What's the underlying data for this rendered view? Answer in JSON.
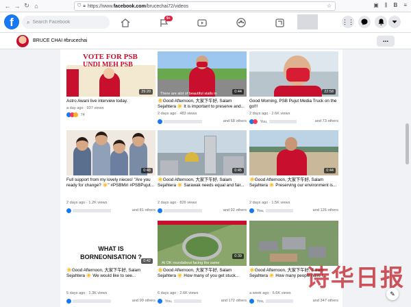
{
  "browser": {
    "url_prefix": "https://www.",
    "url_domain": "facebook.com",
    "url_path": "/brucechai72/videos",
    "account_initial": "B"
  },
  "fb": {
    "search_placeholder": "Search Facebook",
    "notification_badge": "9+",
    "brand_color": "#1877f2"
  },
  "profile": {
    "name": "BRUCE CHAI #brucechai",
    "more_label": "..."
  },
  "videos": [
    {
      "duration": "29:20",
      "title": "Astro Awani live interview today.",
      "meta": "a day ago · 937 views",
      "reactions_text": "74",
      "reactions_right": "",
      "thumb_text_1": "VOTE FOR PSB",
      "thumb_text_2": "UNDI MEH PSB"
    },
    {
      "duration": "0:44",
      "title": "☀️Good Afternoon, 大家下午好, Salam Sejahtera ☀️ It is important to preserve and...",
      "meta": "2 days ago · 483 views",
      "reactions_text": "",
      "reactions_right": "and 68 others",
      "thumb_caption": "There are alot of beautiful stalls in"
    },
    {
      "duration": "22:58",
      "title": "Good Morning, PSB Pujut Media Truck on the go!!!",
      "meta": "2 days ago · 2.6K views",
      "reactions_text": "You,",
      "reactions_right": "and 73 others"
    },
    {
      "duration": "0:48",
      "title": "Full support from my lovely nieces! \"Are you ready for change? ☀️\" #PSBMiri #PSBPujut...",
      "meta": "2 days ago · 1.2K views",
      "reactions_text": "",
      "reactions_right": "and 81 others"
    },
    {
      "duration": "0:45",
      "title": "☀️Good Afternoon, 大家下午好, Salam Sejahtera ☀️ Sarawak needs equal and fair...",
      "meta": "2 days ago · 826 views",
      "reactions_text": "",
      "reactions_right": "and 92 others"
    },
    {
      "duration": "0:44",
      "title": "☀️Good Afternoon, 大家下午好, Salam Sejahtera ☀️ Preserving our environment is...",
      "meta": "2 days ago · 1.5K views",
      "reactions_text": "You,",
      "reactions_right": "and 126 others"
    },
    {
      "duration": "0:42",
      "title": "☀️Good Afternoon, 大家下午好, Salam Sejahtera ☀️ We would like to see...",
      "meta": "5 days ago · 1.3K views",
      "reactions_text": "",
      "reactions_right": "and 99 others",
      "thumb_text_1": "WHAT IS",
      "thumb_text_2": "BORNEONISATION ?"
    },
    {
      "duration": "0:39",
      "title": "☀️Good Afternoon, 大家下午好, Salam Sejahtera ☀️ How many of you get stuck...",
      "meta": "6 days ago · 2.6K views",
      "reactions_text": "You,",
      "reactions_right": "and 172 others",
      "thumb_caption": "At OK roundabout facing the same"
    },
    {
      "duration": "",
      "title": "☀️Good Afternoon, 大家下午好, Salam Sejahtera ☀️ How many people have t...",
      "meta": "a week ago · 6.6K views",
      "reactions_text": "You,",
      "reactions_right": "and 347 others"
    }
  ],
  "watermark": "诗华日报"
}
